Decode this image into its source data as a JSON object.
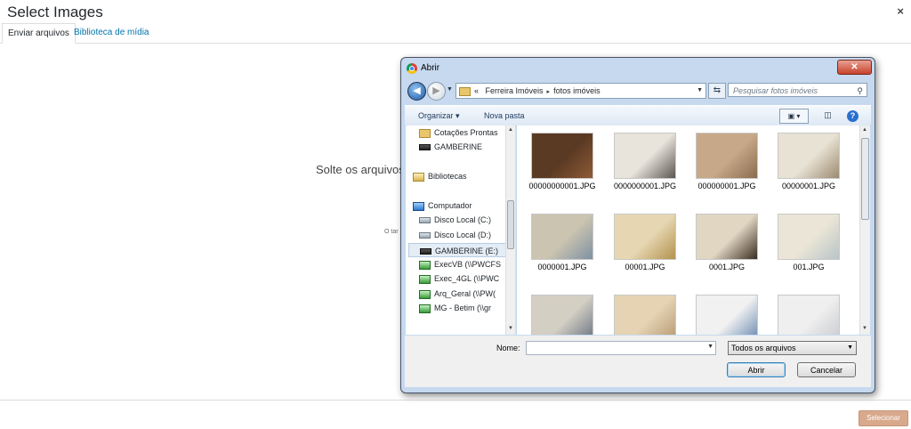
{
  "wp_modal": {
    "title": "Select Images",
    "close_glyph": "×",
    "tabs": [
      {
        "label": "Enviar arquivos",
        "active": true
      },
      {
        "label": "Biblioteca de mídia",
        "active": false
      }
    ],
    "drop_text": "Solte os arquivos",
    "max_size_text": "O tar",
    "select_button": "Selecionar",
    "colors": {
      "link": "#0073aa",
      "select_button": "#d8a98c"
    }
  },
  "dialog": {
    "title": "Abrir",
    "close_glyph": "✕",
    "breadcrumb": {
      "prefix": "«",
      "segments": [
        "Ferreira Imóveis",
        "fotos imóveis"
      ],
      "separator": "▸"
    },
    "search_placeholder": "Pesquisar fotos imóveis",
    "toolbar": {
      "organize": "Organizar ▾",
      "new_folder": "Nova pasta",
      "help": "?"
    },
    "nav_items": [
      {
        "label": "Cotações Prontas",
        "icon": "folder-icon",
        "selected": false
      },
      {
        "label": "GAMBERINE",
        "icon": "drive-icon",
        "selected": false
      },
      {
        "label": "Bibliotecas",
        "icon": "library-icon",
        "selected": false
      },
      {
        "label": "Computador",
        "icon": "computer-icon",
        "selected": false
      },
      {
        "label": "Disco Local (C:)",
        "icon": "drive-icon",
        "selected": false
      },
      {
        "label": "Disco Local (D:)",
        "icon": "drive-icon",
        "selected": false
      },
      {
        "label": "GAMBERINE (E:)",
        "icon": "drive-icon",
        "selected": true
      },
      {
        "label": "ExecVB (\\\\PWCFS",
        "icon": "network-drive-icon",
        "selected": false
      },
      {
        "label": "Exec_4GL (\\\\PWC",
        "icon": "network-drive-icon",
        "selected": false
      },
      {
        "label": "Arq_Geral (\\\\PW(",
        "icon": "network-drive-icon",
        "selected": false
      },
      {
        "label": "MG - Betim (\\\\gr",
        "icon": "network-drive-icon",
        "selected": false
      }
    ],
    "files": [
      {
        "name": "00000000001.JPG",
        "color_a": "#5b3a23",
        "color_b": "#8e5a36"
      },
      {
        "name": "0000000001.JPG",
        "color_a": "#e8e4dc",
        "color_b": "#5a5650"
      },
      {
        "name": "000000001.JPG",
        "color_a": "#c7a98a",
        "color_b": "#8a6b4e"
      },
      {
        "name": "00000001.JPG",
        "color_a": "#e8e2d4",
        "color_b": "#9c8a70"
      },
      {
        "name": "0000001.JPG",
        "color_a": "#cbc4b0",
        "color_b": "#7f91a3"
      },
      {
        "name": "00001.JPG",
        "color_a": "#e6d7b2",
        "color_b": "#b3924f"
      },
      {
        "name": "0001.JPG",
        "color_a": "#e0d6c2",
        "color_b": "#3b2b22"
      },
      {
        "name": "001.JPG",
        "color_a": "#eae5d6",
        "color_b": "#b9c4c8"
      },
      {
        "name": "",
        "color_a": "#d4cfc3",
        "color_b": "#6a7585"
      },
      {
        "name": "",
        "color_a": "#e5d3b3",
        "color_b": "#b79a73"
      },
      {
        "name": "",
        "color_a": "#f1f1f1",
        "color_b": "#6a89b0"
      },
      {
        "name": "",
        "color_a": "#efefef",
        "color_b": "#c9ccd0"
      }
    ],
    "filename_label": "Nome:",
    "filename_value": "",
    "filter_value": "Todos os arquivos",
    "open_button": "Abrir",
    "cancel_button": "Cancelar"
  }
}
